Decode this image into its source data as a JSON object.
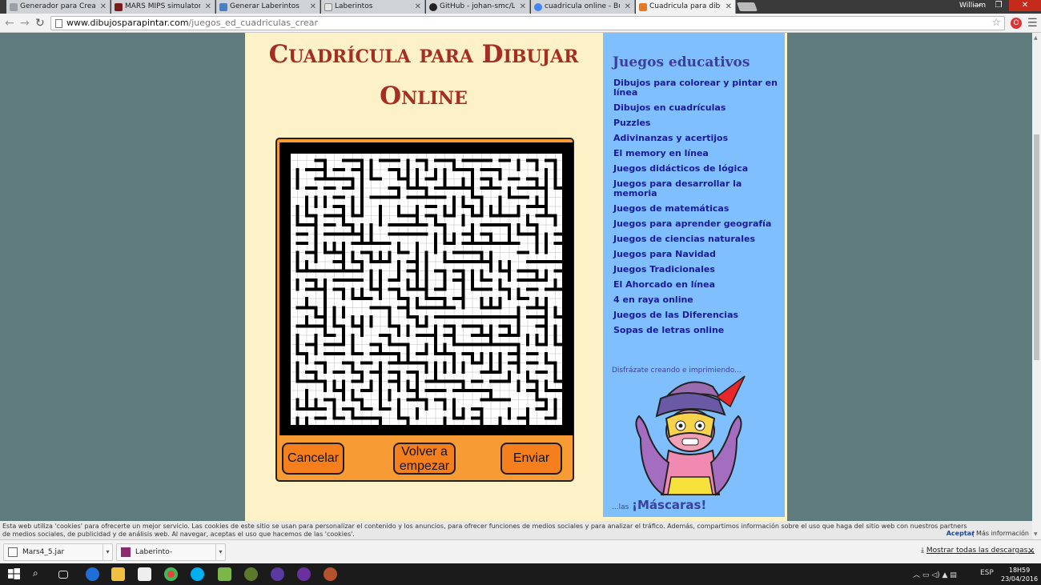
{
  "browser": {
    "tabs": [
      {
        "title": "Generador para Crear lab",
        "color": "#9aa0a6"
      },
      {
        "title": "MARS MIPS simulator - M",
        "color": "#7b1c1c"
      },
      {
        "title": "Generar Laberintos",
        "color": "#4a7fc1"
      },
      {
        "title": "Laberintos",
        "color": "#9aa0a6"
      },
      {
        "title": "GitHub - johan-smc/Lab",
        "color": "#222222"
      },
      {
        "title": "cuadricula online - Busca",
        "color": "#4285f4"
      },
      {
        "title": "Cuadricula para dibujar",
        "color": "#e07b2c"
      }
    ],
    "user": "William",
    "url_host": "www.dibujosparapintar.com",
    "url_path": "/juegos_ed_cuadriculas_crear"
  },
  "page": {
    "title_line1": "Cuadrícula para Dibujar",
    "title_line2": "Online",
    "buttons": {
      "cancel": "Cancelar",
      "reset_line1": "Volver a",
      "reset_line2": "empezar",
      "send": "Enviar"
    },
    "colors": {
      "title": "#a52d22",
      "frame": "#f79b34",
      "button": "#f57f1d",
      "sidebar": "#7fbffd",
      "link": "#1a1a99"
    }
  },
  "sidebar": {
    "title": "Juegos educativos",
    "links": [
      "Dibujos para colorear y pintar en línea",
      "Dibujos en cuadrículas",
      "Puzzles",
      "Adivinanzas y acertijos",
      "El memory en línea",
      "Juegos didácticos de lógica",
      "Juegos para desarrollar la memoria",
      "Juegos de matemáticas",
      "Juegos para aprender geografía",
      "Juegos de ciencias naturales",
      "Juegos para Navidad",
      "Juegos Tradicionales",
      "El Ahorcado en línea",
      "4 en raya online",
      "Juegos de las Diferencias",
      "Sopas de letras online"
    ],
    "promo_text": "Disfrázate creando e imprimiendo...",
    "promo_small": "...las",
    "promo_big": "¡Máscaras!"
  },
  "cookie_bar": {
    "text": "Esta web utiliza 'cookies' para ofrecerte un mejor servicio. Las cookies de este sitio se usan para personalizar el contenido y los anuncios, para ofrecer funciones de medios sociales y para analizar el tráfico. Además, compartimos información sobre el uso que haga del sitio web con nuestros partners de medios sociales, de publicidad y de análisis web. Al navegar, aceptas el uso que hacemos de las 'cookies'.",
    "accept": "Aceptar",
    "more": "| Más información"
  },
  "downloads": {
    "items": [
      "Mars4_5.jar",
      "Laberinto-Maquinas-....zip"
    ],
    "show_all": "Mostrar todas las descargas..."
  },
  "taskbar": {
    "lang": "ESP",
    "time": "18H59",
    "date": "23/04/2016"
  }
}
